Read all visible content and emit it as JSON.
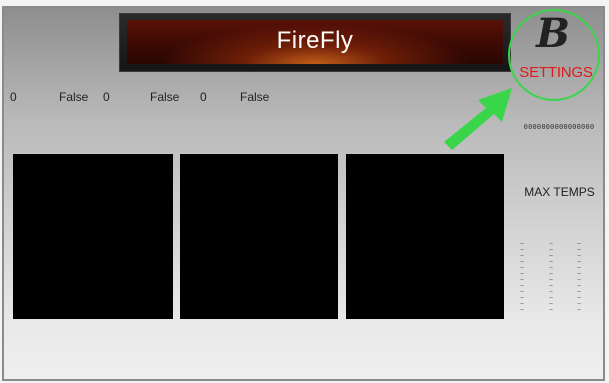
{
  "app": {
    "title": "FireFly"
  },
  "status_row": [
    {
      "value": "0"
    },
    {
      "value": "False"
    },
    {
      "value": "0"
    },
    {
      "value": "False"
    },
    {
      "value": "0"
    },
    {
      "value": "False"
    }
  ],
  "logo": {
    "glyph": "B",
    "settings_label": "SETTINGS"
  },
  "digits": "0000000000000000",
  "temps": {
    "label": "MAX TEMPS",
    "placeholder": "–"
  },
  "colors": {
    "accent_red": "#e11919",
    "highlight_green": "#39d64a"
  },
  "icons": {
    "pointer": "green-arrow-icon"
  }
}
